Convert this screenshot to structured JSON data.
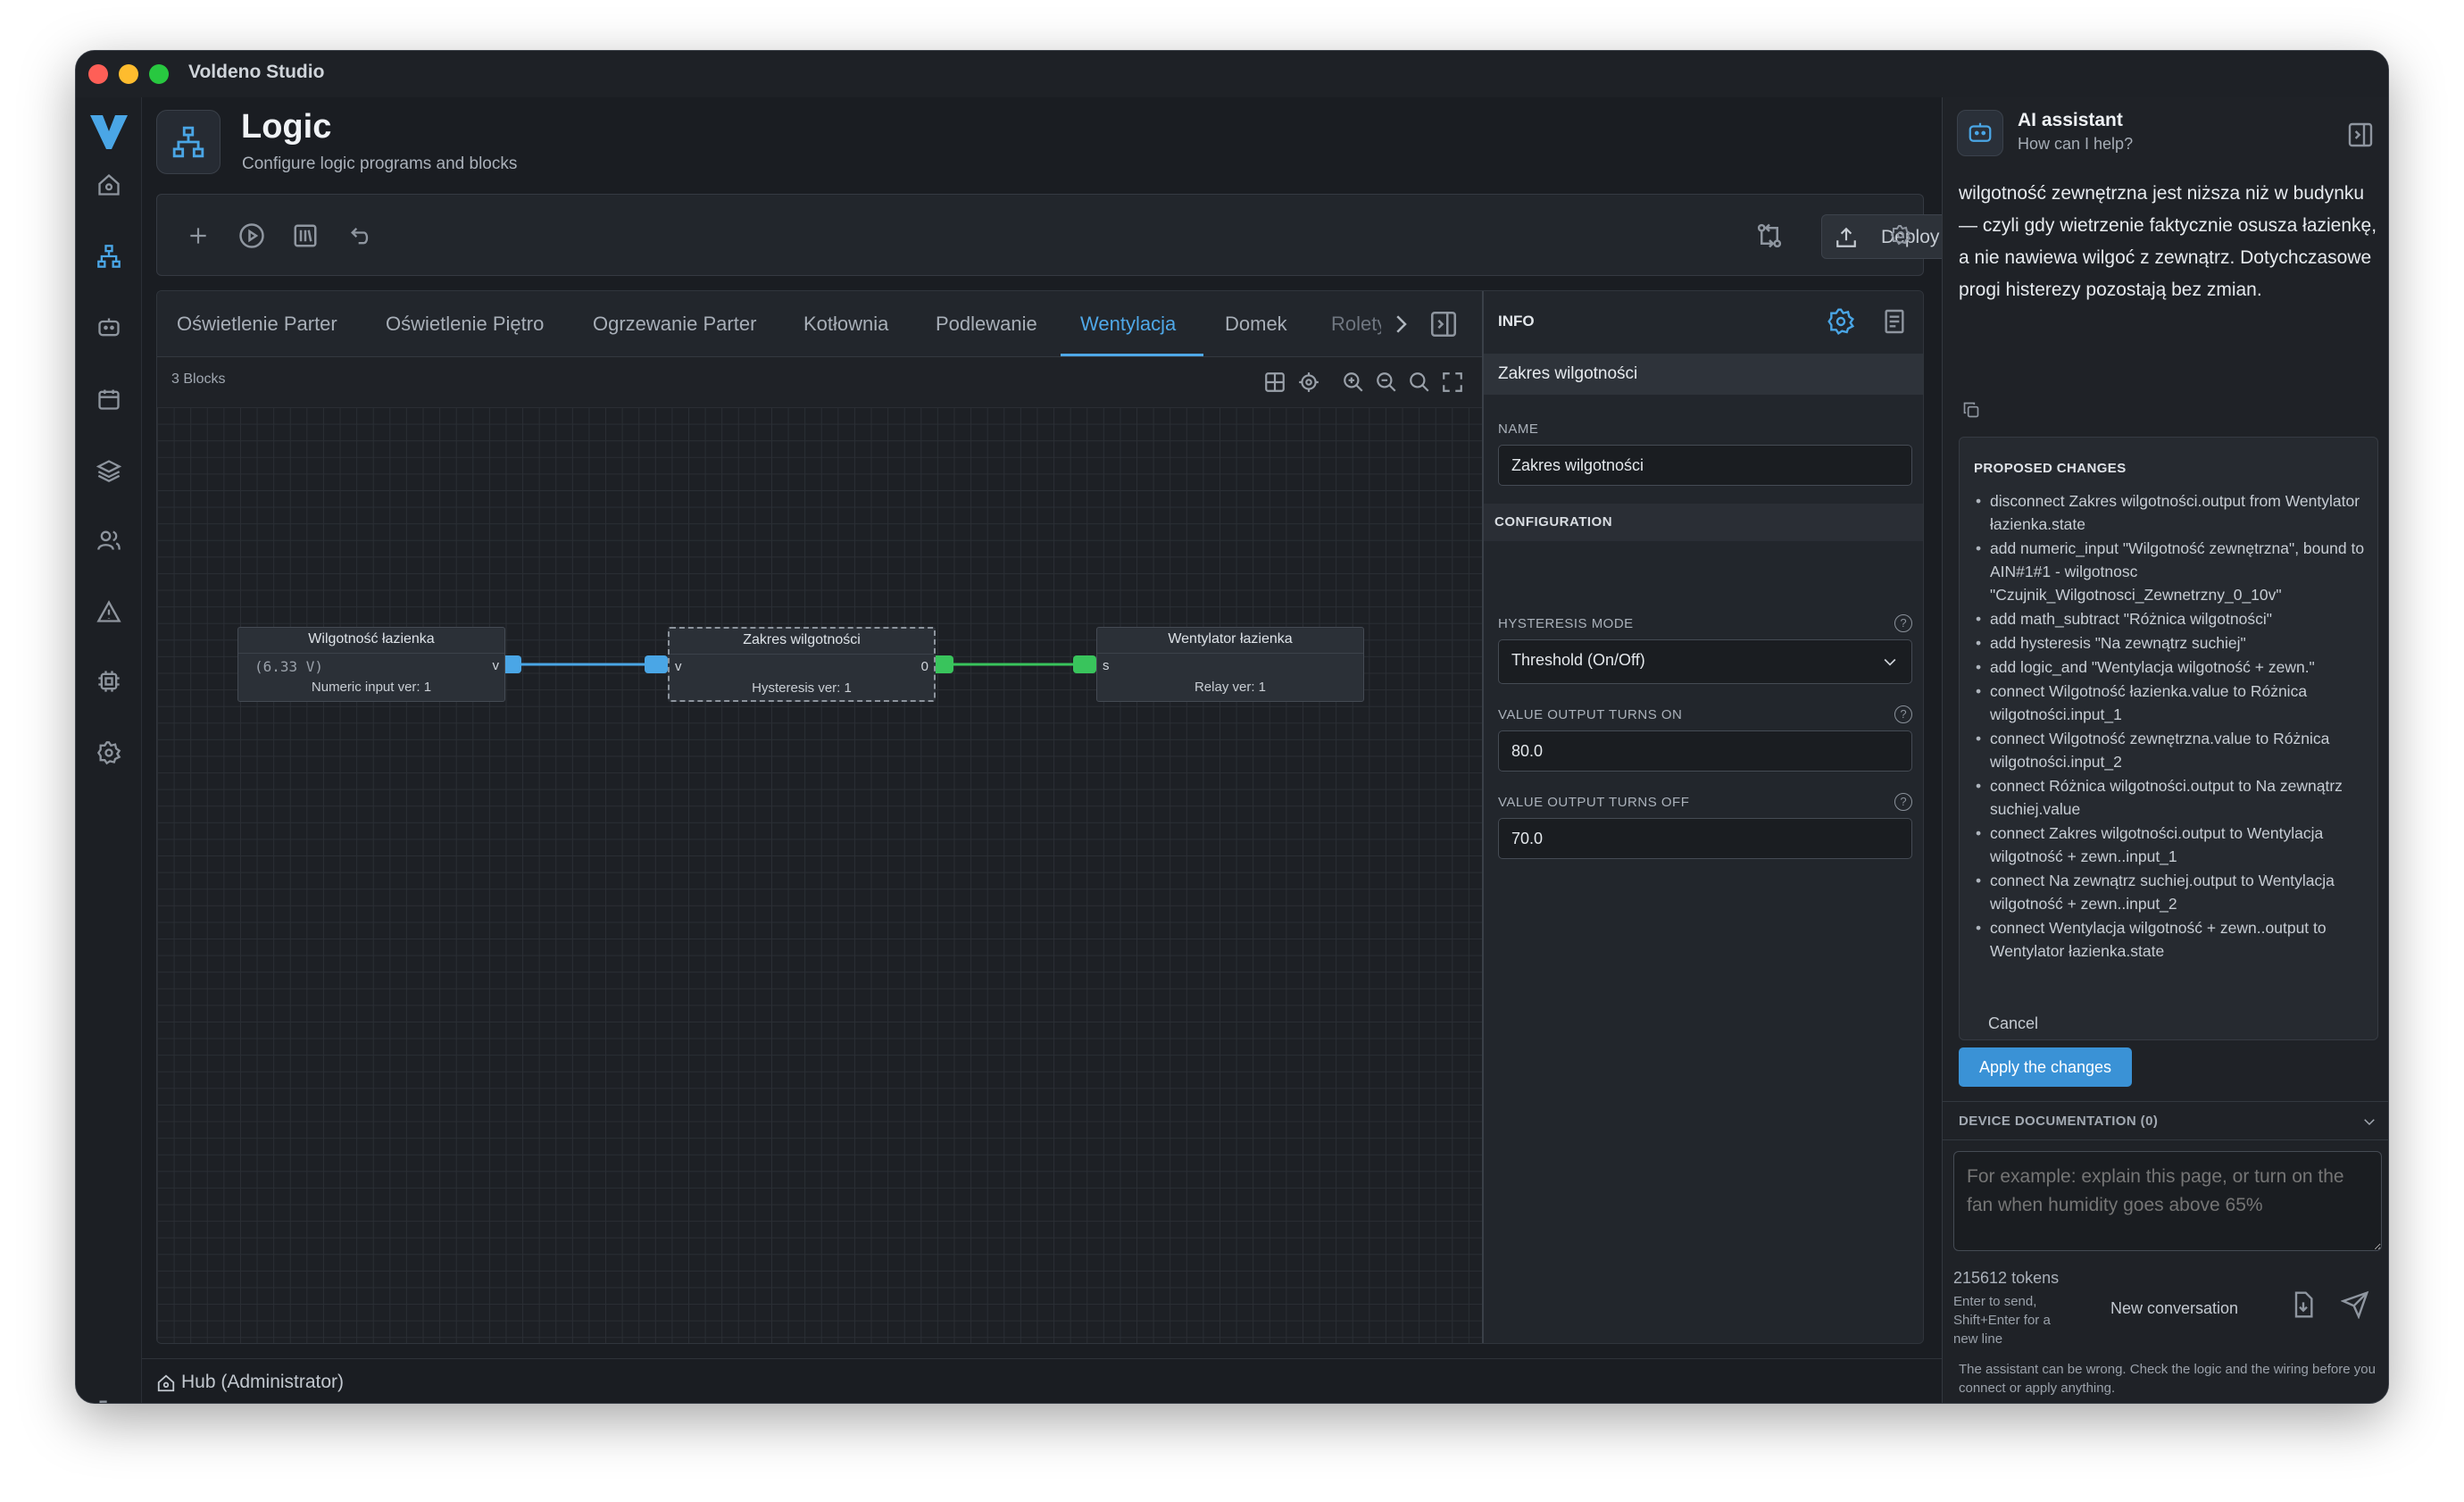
{
  "window": {
    "title": "Voldeno Studio"
  },
  "header": {
    "title": "Logic",
    "subtitle": "Configure logic programs and blocks"
  },
  "toolbar": {
    "deploy_label": "Deploy"
  },
  "tabs": [
    "Oświetlenie Parter",
    "Oświetlenie Piętro",
    "Ogrzewanie Parter",
    "Kotłownia",
    "Podlewanie",
    "Wentylacja",
    "Domek",
    "Rolety"
  ],
  "active_tab": "Wentylacja",
  "canvas": {
    "blocks_count": "3 Blocks",
    "nodes": [
      {
        "title": "Wilgotność łazienka",
        "value": "(6.33 V)",
        "footer": "Numeric input ver: 1",
        "port_out": "v"
      },
      {
        "title": "Zakres wilgotności",
        "footer": "Hysteresis ver: 1",
        "port_in": "v",
        "port_out": "0"
      },
      {
        "title": "Wentylator łazienka",
        "footer": "Relay ver: 1",
        "port_in": "s"
      }
    ]
  },
  "info": {
    "title": "INFO",
    "selected": "Zakres wilgotności",
    "name_label": "NAME",
    "name_value": "Zakres wilgotności",
    "config_label": "CONFIGURATION",
    "hysteresis_label": "HYSTERESIS MODE",
    "hysteresis_value": "Threshold (On/Off)",
    "on_label": "VALUE OUTPUT TURNS ON",
    "on_value": "80.0",
    "off_label": "VALUE OUTPUT TURNS OFF",
    "off_value": "70.0"
  },
  "ai": {
    "title": "AI assistant",
    "subtitle": "How can I help?",
    "message": "wilgotność zewnętrzna jest niższa niż w budynku — czyli gdy wietrzenie faktycznie osusza łazienkę, a nie nawiewa wilgoć z zewnątrz. Dotychczasowe progi histerezy pozostają bez zmian.",
    "proposed_title": "PROPOSED CHANGES",
    "changes": [
      "disconnect Zakres wilgotności.output from Wentylator łazienka.state",
      "add numeric_input \"Wilgotność zewnętrzna\", bound to AIN#1#1 - wilgotnosc \"Czujnik_Wilgotnosci_Zewnetrzny_0_10v\"",
      "add math_subtract \"Różnica wilgotności\"",
      "add hysteresis \"Na zewnątrz suchiej\"",
      "add logic_and \"Wentylacja wilgotność + zewn.\"",
      "connect Wilgotność łazienka.value to Różnica wilgotności.input_1",
      "connect Wilgotność zewnętrzna.value to Różnica wilgotności.input_2",
      "connect Różnica wilgotności.output to Na zewnątrz suchiej.value",
      "connect Zakres wilgotności.output to Wentylacja wilgotność + zewn..input_1",
      "connect Na zewnątrz suchiej.output to Wentylacja wilgotność + zewn..input_2",
      "connect Wentylacja wilgotność + zewn..output to Wentylator łazienka.state"
    ],
    "cancel_label": "Cancel",
    "apply_label": "Apply the changes",
    "device_doc_label": "DEVICE DOCUMENTATION (0)",
    "input_placeholder": "For example: explain this page, or turn on the fan when humidity goes above 65%",
    "tokens": "215612 tokens",
    "hint": "Enter to send, Shift+Enter for a new line",
    "new_conversation": "New conversation",
    "disclaimer": "The assistant can be wrong. Check the logic and the wiring before you connect or apply anything."
  },
  "footer": {
    "hub_label": "Hub (Administrator)"
  },
  "colors": {
    "accent": "#4fa8e8",
    "port_blue": "#4aa6e6",
    "port_green": "#39c45c",
    "apply": "#3a92d6"
  }
}
